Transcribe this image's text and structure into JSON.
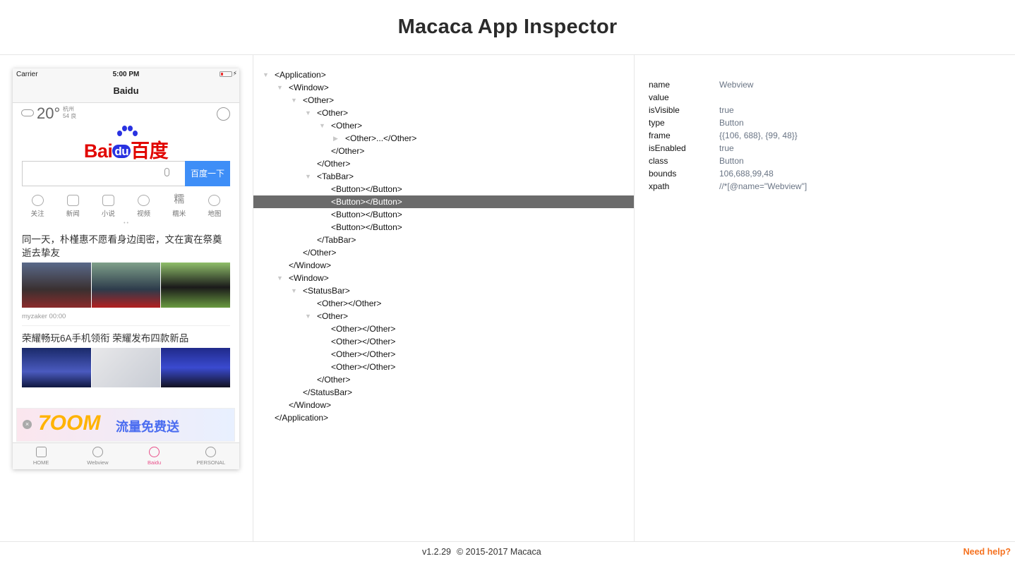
{
  "header": {
    "title": "Macaca App Inspector"
  },
  "phone": {
    "status": {
      "carrier": "Carrier",
      "time": "5:00 PM",
      "bolt": "⚡"
    },
    "nav_title": "Baidu",
    "weather": {
      "temp": "20°",
      "city": "杭州",
      "aqi": "54 良"
    },
    "logo": {
      "bai": "Bai",
      "du": "du",
      "baidu_cn": "百度"
    },
    "search": {
      "button_label": "百度一下",
      "placeholder": ""
    },
    "quick_links": [
      {
        "label": "关注",
        "icon": "heart-icon"
      },
      {
        "label": "新闻",
        "icon": "news-icon"
      },
      {
        "label": "小说",
        "icon": "book-icon"
      },
      {
        "label": "视频",
        "icon": "play-icon"
      },
      {
        "label": "糯米",
        "icon": "nuomi-icon",
        "glyph": "糯"
      },
      {
        "label": "地图",
        "icon": "map-pin-icon"
      }
    ],
    "page_dots": "• •",
    "news": [
      {
        "title": "同一天，朴槿惠不愿看身边闺密，文在寅在祭奠逝去挚友",
        "meta": "myzaker  00:00"
      },
      {
        "title": "荣耀畅玩6A手机领衔 荣耀发布四款新品"
      }
    ],
    "banner": {
      "big": "7OOM",
      "text": "流量免费送",
      "close": "×"
    },
    "tabs": [
      {
        "label": "HOME",
        "icon": "home-icon",
        "active": false
      },
      {
        "label": "Webview",
        "icon": "globe-icon",
        "active": false
      },
      {
        "label": "Baidu",
        "icon": "globe-icon",
        "active": true
      },
      {
        "label": "PERSONAL",
        "icon": "person-icon",
        "active": false
      }
    ]
  },
  "tree": [
    {
      "text": "<Application>",
      "depth": 0,
      "toggle": "open"
    },
    {
      "text": "<Window>",
      "depth": 1,
      "toggle": "open"
    },
    {
      "text": "<Other>",
      "depth": 2,
      "toggle": "open"
    },
    {
      "text": "<Other>",
      "depth": 3,
      "toggle": "open"
    },
    {
      "text": "<Other>",
      "depth": 4,
      "toggle": "open"
    },
    {
      "text": "<Other>...</Other>",
      "depth": 5,
      "toggle": "closed"
    },
    {
      "text": "</Other>",
      "depth": 4,
      "toggle": "none"
    },
    {
      "text": "</Other>",
      "depth": 3,
      "toggle": "none"
    },
    {
      "text": "<TabBar>",
      "depth": 3,
      "toggle": "open"
    },
    {
      "text": "<Button></Button>",
      "depth": 4,
      "toggle": "none"
    },
    {
      "text": "<Button></Button>",
      "depth": 4,
      "toggle": "none",
      "selected": true
    },
    {
      "text": "<Button></Button>",
      "depth": 4,
      "toggle": "none"
    },
    {
      "text": "<Button></Button>",
      "depth": 4,
      "toggle": "none"
    },
    {
      "text": "</TabBar>",
      "depth": 3,
      "toggle": "none"
    },
    {
      "text": "</Other>",
      "depth": 2,
      "toggle": "none"
    },
    {
      "text": "</Window>",
      "depth": 1,
      "toggle": "none"
    },
    {
      "text": "<Window>",
      "depth": 1,
      "toggle": "open"
    },
    {
      "text": "<StatusBar>",
      "depth": 2,
      "toggle": "open"
    },
    {
      "text": "<Other></Other>",
      "depth": 3,
      "toggle": "none"
    },
    {
      "text": "<Other>",
      "depth": 3,
      "toggle": "open"
    },
    {
      "text": "<Other></Other>",
      "depth": 4,
      "toggle": "none"
    },
    {
      "text": "<Other></Other>",
      "depth": 4,
      "toggle": "none"
    },
    {
      "text": "<Other></Other>",
      "depth": 4,
      "toggle": "none"
    },
    {
      "text": "<Other></Other>",
      "depth": 4,
      "toggle": "none"
    },
    {
      "text": "</Other>",
      "depth": 3,
      "toggle": "none"
    },
    {
      "text": "</StatusBar>",
      "depth": 2,
      "toggle": "none"
    },
    {
      "text": "</Window>",
      "depth": 1,
      "toggle": "none"
    },
    {
      "text": "</Application>",
      "depth": 0,
      "toggle": "none"
    }
  ],
  "properties": [
    {
      "key": "name",
      "value": "Webview"
    },
    {
      "key": "value",
      "value": ""
    },
    {
      "key": "isVisible",
      "value": "true"
    },
    {
      "key": "type",
      "value": "Button"
    },
    {
      "key": "frame",
      "value": "{{106, 688}, {99, 48}}"
    },
    {
      "key": "isEnabled",
      "value": "true"
    },
    {
      "key": "class",
      "value": "Button"
    },
    {
      "key": "bounds",
      "value": "106,688,99,48"
    },
    {
      "key": "xpath",
      "value": "//*[@name=\"Webview\"]"
    }
  ],
  "footer": {
    "version": "v1.2.29",
    "copyright": "© 2015-2017 Macaca",
    "help": "Need help?"
  },
  "colors": {
    "accent": "#f5711f",
    "selected_row": "#6b6b6b",
    "search_button": "#3e8ef7",
    "active_tab": "#e8508a"
  }
}
